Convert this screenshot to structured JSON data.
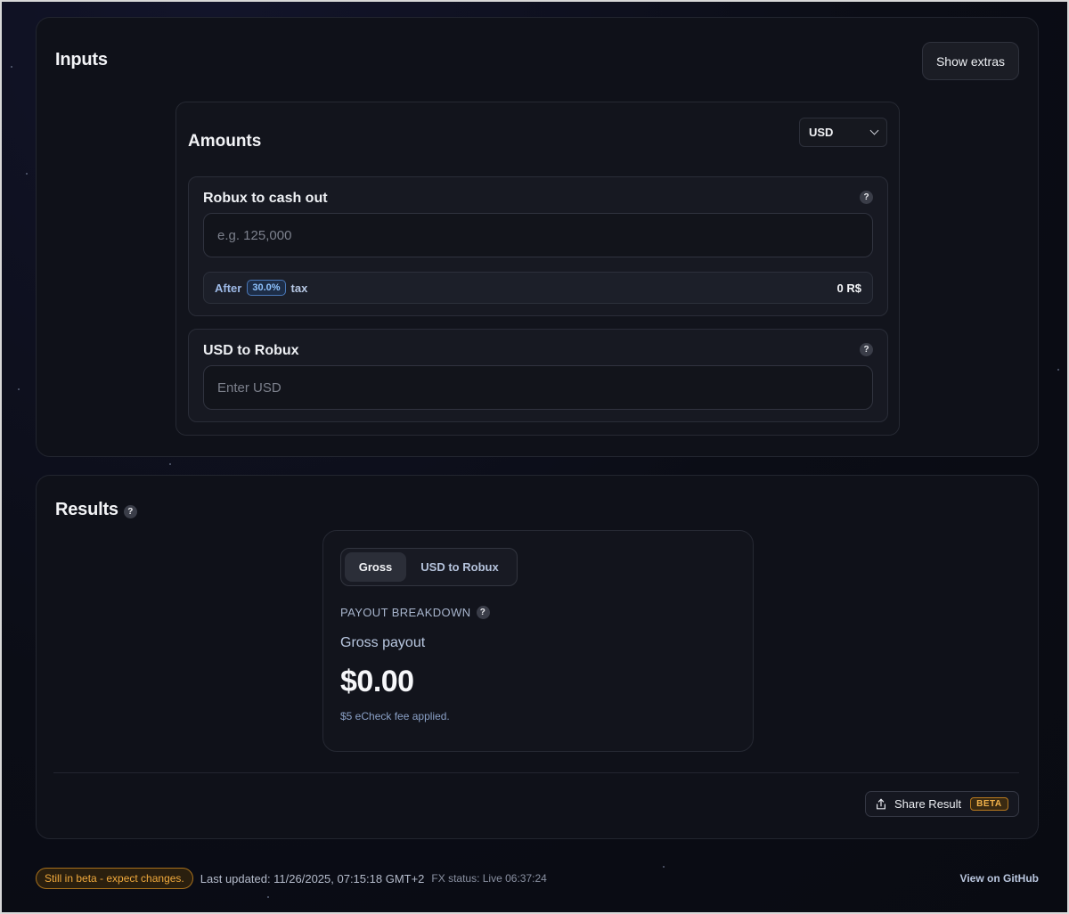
{
  "inputs": {
    "title": "Inputs",
    "show_extras_label": "Show extras",
    "amounts": {
      "title": "Amounts",
      "currency": "USD",
      "robux_card": {
        "title": "Robux to cash out",
        "help": "?",
        "placeholder": "e.g. 125,000",
        "after_label": "After",
        "tax_percent": "30.0%",
        "tax_label": "tax",
        "after_tax_value": "0 R$"
      },
      "usd_card": {
        "title": "USD to Robux",
        "help": "?",
        "placeholder": "Enter USD"
      }
    }
  },
  "results": {
    "title": "Results",
    "help": "?",
    "tabs": [
      {
        "label": "Gross",
        "active": true
      },
      {
        "label": "USD to Robux",
        "active": false
      }
    ],
    "breakdown_label": "PAYOUT BREAKDOWN",
    "gross_label": "Gross payout",
    "gross_value": "$0.00",
    "fee_note": "$5 eCheck fee applied.",
    "share_label": "Share Result",
    "share_badge": "BETA"
  },
  "footer": {
    "beta_notice": "Still in beta - expect changes.",
    "last_updated": "Last updated: 11/26/2025, 07:15:18 GMT+2",
    "fx_status": "FX status: Live 06:37:24",
    "github_link": "View on GitHub"
  },
  "colors": {
    "background": "#0a0c14",
    "panel": "#0f1119",
    "accent_blue": "#8fc3ff",
    "beta_orange": "#f0a93c"
  }
}
